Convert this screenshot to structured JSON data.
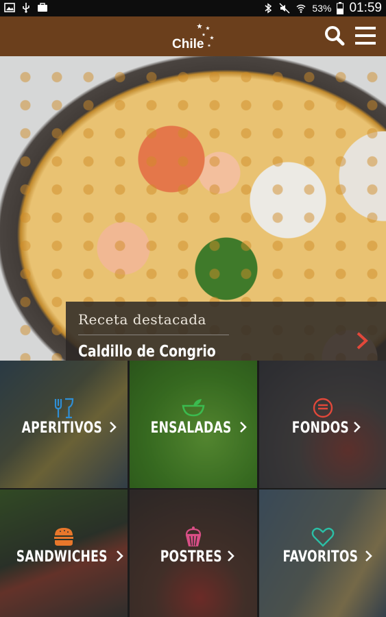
{
  "status_bar": {
    "battery": "53%",
    "time": "01:59",
    "left_icons": [
      "image-icon",
      "usb-icon",
      "briefcase-icon"
    ],
    "right_icons": [
      "bluetooth-icon",
      "mute-icon",
      "wifi-icon",
      "battery-icon"
    ]
  },
  "header": {
    "logo_text": "Chile",
    "actions": [
      "search-icon",
      "menu-icon"
    ]
  },
  "featured": {
    "kicker": "Receta destacada",
    "title": "Caldillo de Congrio"
  },
  "categories": [
    {
      "label": "APERITIVOS",
      "icon": "utensils-icon",
      "icon_color": "#2f8fd6"
    },
    {
      "label": "ENSALADAS",
      "icon": "salad-bowl-icon",
      "icon_color": "#3bbb4f"
    },
    {
      "label": "FONDOS",
      "icon": "plate-icon",
      "icon_color": "#e2483a"
    },
    {
      "label": "SANDWICHES",
      "icon": "burger-icon",
      "icon_color": "#e8772b"
    },
    {
      "label": "POSTRES",
      "icon": "cupcake-icon",
      "icon_color": "#d94f86"
    },
    {
      "label": "FAVORITOS",
      "icon": "heart-icon",
      "icon_color": "#2bbfa6"
    }
  ],
  "colors": {
    "header_bg": "#6b3f1c",
    "accent_chevron": "#e2483a"
  }
}
